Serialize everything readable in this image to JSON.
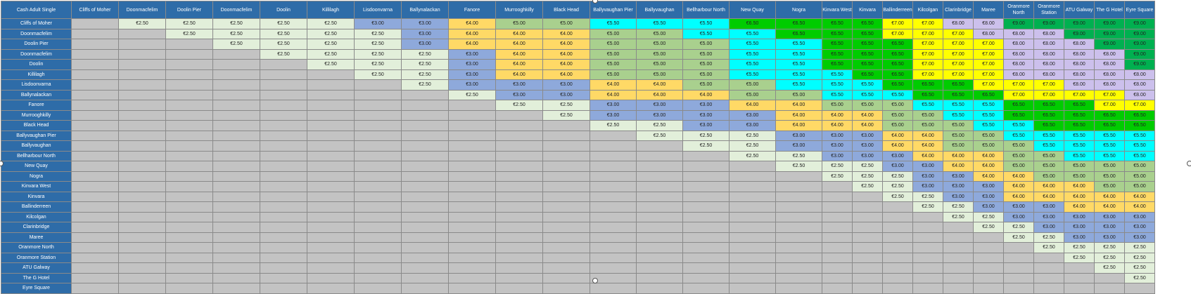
{
  "corner": "Cash Adult Single",
  "stops": [
    "Cliffs of Moher",
    "Doonmacfelim",
    "Doolin Pier",
    "Doonmacfelim",
    "Doolin",
    "Killilagh",
    "Lisdoonvarna",
    "Ballynalackan",
    "Fanore",
    "Murrooghkilly",
    "Black Head",
    "Ballyvaughan Pier",
    "Ballyvaughan",
    "Bellharbour North",
    "New Quay",
    "Nogra",
    "Kinvara West",
    "Kinvara",
    "Ballinderreen",
    "Kilcolgan",
    "Clarinbridge",
    "Maree",
    "Oranmore North",
    "Oranmore Station",
    "ATU Galway",
    "The G Hotel",
    "Eyre Square"
  ],
  "colors": {
    "header_bg": "#2e6ca8",
    "empty": "#c3c3c3",
    "2.50": "#e2efda",
    "3.00": "#8ea9db",
    "4.00": "#ffd966",
    "5.00": "#a9d08e",
    "5.50": "#00ffff",
    "6.50": "#00cc00",
    "7.00": "#ffff00",
    "8.00": "#ccc0ec",
    "9.00": "#00b050"
  },
  "fares": [
    [
      "",
      "€2.50",
      "€2.50",
      "€2.50",
      "€2.50",
      "€2.50",
      "€3.00",
      "€3.00",
      "€4.00",
      "€5.00",
      "€5.00",
      "€5.50",
      "€5.50",
      "€5.50",
      "€6.50",
      "€6.50",
      "€6.50",
      "€6.50",
      "€7.00",
      "€7.00",
      "€8.00",
      "€8.00",
      "€9.00",
      "€9.00",
      "€9.00",
      "€9.00",
      "€9.00"
    ],
    [
      "",
      "",
      "€2.50",
      "€2.50",
      "€2.50",
      "€2.50",
      "€2.50",
      "€3.00",
      "€4.00",
      "€4.00",
      "€4.00",
      "€5.00",
      "€5.00",
      "€5.50",
      "€5.50",
      "€6.50",
      "€6.50",
      "€6.50",
      "€7.00",
      "€7.00",
      "€7.00",
      "€8.00",
      "€8.00",
      "€8.00",
      "€9.00",
      "€9.00",
      "€9.00"
    ],
    [
      "",
      "",
      "",
      "€2.50",
      "€2.50",
      "€2.50",
      "€2.50",
      "€3.00",
      "€4.00",
      "€4.00",
      "€4.00",
      "€5.00",
      "€5.00",
      "€5.00",
      "€5.50",
      "€5.50",
      "€6.50",
      "€6.50",
      "€6.50",
      "€7.00",
      "€7.00",
      "€7.00",
      "€8.00",
      "€8.00",
      "€8.00",
      "€9.00",
      "€9.00"
    ],
    [
      "",
      "",
      "",
      "",
      "€2.50",
      "€2.50",
      "€2.50",
      "€2.50",
      "€3.00",
      "€4.00",
      "€4.00",
      "€5.00",
      "€5.00",
      "€5.00",
      "€5.50",
      "€5.50",
      "€6.50",
      "€6.50",
      "€6.50",
      "€7.00",
      "€7.00",
      "€7.00",
      "€8.00",
      "€8.00",
      "€8.00",
      "€8.00",
      "€9.00"
    ],
    [
      "",
      "",
      "",
      "",
      "",
      "€2.50",
      "€2.50",
      "€2.50",
      "€3.00",
      "€4.00",
      "€4.00",
      "€5.00",
      "€5.00",
      "€5.00",
      "€5.50",
      "€5.50",
      "€6.50",
      "€6.50",
      "€6.50",
      "€7.00",
      "€7.00",
      "€7.00",
      "€8.00",
      "€8.00",
      "€8.00",
      "€8.00",
      "€9.00"
    ],
    [
      "",
      "",
      "",
      "",
      "",
      "",
      "€2.50",
      "€2.50",
      "€3.00",
      "€4.00",
      "€4.00",
      "€5.00",
      "€5.00",
      "€5.00",
      "€5.50",
      "€5.50",
      "€5.50",
      "€6.50",
      "€6.50",
      "€7.00",
      "€7.00",
      "€7.00",
      "€8.00",
      "€8.00",
      "€8.00",
      "€8.00",
      "€8.00"
    ],
    [
      "",
      "",
      "",
      "",
      "",
      "",
      "",
      "€2.50",
      "€3.00",
      "€3.00",
      "€3.00",
      "€4.00",
      "€4.00",
      "€5.00",
      "€5.00",
      "€5.50",
      "€5.50",
      "€5.50",
      "€6.50",
      "€6.50",
      "€6.50",
      "€7.00",
      "€7.00",
      "€7.00",
      "€8.00",
      "€8.00",
      "€8.00"
    ],
    [
      "",
      "",
      "",
      "",
      "",
      "",
      "",
      "",
      "€2.50",
      "€3.00",
      "€3.00",
      "€4.00",
      "€4.00",
      "€4.00",
      "€5.00",
      "€5.00",
      "€5.50",
      "€5.50",
      "€5.50",
      "€6.50",
      "€6.50",
      "€6.50",
      "€7.00",
      "€7.00",
      "€7.00",
      "€7.00",
      "€8.00"
    ],
    [
      "",
      "",
      "",
      "",
      "",
      "",
      "",
      "",
      "",
      "€2.50",
      "€2.50",
      "€3.00",
      "€3.00",
      "€3.00",
      "€4.00",
      "€4.00",
      "€5.00",
      "€5.00",
      "€5.00",
      "€5.50",
      "€5.50",
      "€5.50",
      "€6.50",
      "€6.50",
      "€6.50",
      "€7.00",
      "€7.00"
    ],
    [
      "",
      "",
      "",
      "",
      "",
      "",
      "",
      "",
      "",
      "",
      "€2.50",
      "€3.00",
      "€3.00",
      "€3.00",
      "€3.00",
      "€4.00",
      "€4.00",
      "€4.00",
      "€5.00",
      "€5.00",
      "€5.50",
      "€5.50",
      "€6.50",
      "€6.50",
      "€6.50",
      "€6.50",
      "€6.50"
    ],
    [
      "",
      "",
      "",
      "",
      "",
      "",
      "",
      "",
      "",
      "",
      "",
      "€2.50",
      "€2.50",
      "€3.00",
      "€3.00",
      "€4.00",
      "€4.00",
      "€4.00",
      "€5.00",
      "€5.00",
      "€5.00",
      "€5.50",
      "€5.50",
      "€6.50",
      "€6.50",
      "€6.50",
      "€6.50"
    ],
    [
      "",
      "",
      "",
      "",
      "",
      "",
      "",
      "",
      "",
      "",
      "",
      "",
      "€2.50",
      "€2.50",
      "€2.50",
      "€3.00",
      "€3.00",
      "€3.00",
      "€4.00",
      "€4.00",
      "€5.00",
      "€5.00",
      "€5.50",
      "€5.50",
      "€5.50",
      "€5.50",
      "€5.50"
    ],
    [
      "",
      "",
      "",
      "",
      "",
      "",
      "",
      "",
      "",
      "",
      "",
      "",
      "",
      "€2.50",
      "€2.50",
      "€3.00",
      "€3.00",
      "€3.00",
      "€4.00",
      "€4.00",
      "€5.00",
      "€5.00",
      "€5.00",
      "€5.50",
      "€5.50",
      "€5.50",
      "€5.50"
    ],
    [
      "",
      "",
      "",
      "",
      "",
      "",
      "",
      "",
      "",
      "",
      "",
      "",
      "",
      "",
      "€2.50",
      "€2.50",
      "€3.00",
      "€3.00",
      "€3.00",
      "€4.00",
      "€4.00",
      "€4.00",
      "€5.00",
      "€5.00",
      "€5.50",
      "€5.50",
      "€5.50"
    ],
    [
      "",
      "",
      "",
      "",
      "",
      "",
      "",
      "",
      "",
      "",
      "",
      "",
      "",
      "",
      "",
      "€2.50",
      "€2.50",
      "€2.50",
      "€3.00",
      "€3.00",
      "€4.00",
      "€4.00",
      "€5.00",
      "€5.00",
      "€5.00",
      "€5.00",
      "€5.00"
    ],
    [
      "",
      "",
      "",
      "",
      "",
      "",
      "",
      "",
      "",
      "",
      "",
      "",
      "",
      "",
      "",
      "",
      "€2.50",
      "€2.50",
      "€2.50",
      "€3.00",
      "€3.00",
      "€4.00",
      "€4.00",
      "€5.00",
      "€5.00",
      "€5.00",
      "€5.00"
    ],
    [
      "",
      "",
      "",
      "",
      "",
      "",
      "",
      "",
      "",
      "",
      "",
      "",
      "",
      "",
      "",
      "",
      "",
      "€2.50",
      "€2.50",
      "€3.00",
      "€3.00",
      "€3.00",
      "€4.00",
      "€4.00",
      "€4.00",
      "€5.00",
      "€5.00"
    ],
    [
      "",
      "",
      "",
      "",
      "",
      "",
      "",
      "",
      "",
      "",
      "",
      "",
      "",
      "",
      "",
      "",
      "",
      "",
      "€2.50",
      "€2.50",
      "€3.00",
      "€3.00",
      "€4.00",
      "€4.00",
      "€4.00",
      "€4.00",
      "€4.00"
    ],
    [
      "",
      "",
      "",
      "",
      "",
      "",
      "",
      "",
      "",
      "",
      "",
      "",
      "",
      "",
      "",
      "",
      "",
      "",
      "",
      "€2.50",
      "€2.50",
      "€3.00",
      "€3.00",
      "€3.00",
      "€4.00",
      "€4.00",
      "€4.00"
    ],
    [
      "",
      "",
      "",
      "",
      "",
      "",
      "",
      "",
      "",
      "",
      "",
      "",
      "",
      "",
      "",
      "",
      "",
      "",
      "",
      "",
      "€2.50",
      "€2.50",
      "€3.00",
      "€3.00",
      "€3.00",
      "€3.00",
      "€3.00"
    ],
    [
      "",
      "",
      "",
      "",
      "",
      "",
      "",
      "",
      "",
      "",
      "",
      "",
      "",
      "",
      "",
      "",
      "",
      "",
      "",
      "",
      "",
      "€2.50",
      "€2.50",
      "€3.00",
      "€3.00",
      "€3.00",
      "€3.00"
    ],
    [
      "",
      "",
      "",
      "",
      "",
      "",
      "",
      "",
      "",
      "",
      "",
      "",
      "",
      "",
      "",
      "",
      "",
      "",
      "",
      "",
      "",
      "",
      "€2.50",
      "€2.50",
      "€3.00",
      "€3.00",
      "€3.00"
    ],
    [
      "",
      "",
      "",
      "",
      "",
      "",
      "",
      "",
      "",
      "",
      "",
      "",
      "",
      "",
      "",
      "",
      "",
      "",
      "",
      "",
      "",
      "",
      "",
      "€2.50",
      "€2.50",
      "€2.50",
      "€2.50"
    ],
    [
      "",
      "",
      "",
      "",
      "",
      "",
      "",
      "",
      "",
      "",
      "",
      "",
      "",
      "",
      "",
      "",
      "",
      "",
      "",
      "",
      "",
      "",
      "",
      "",
      "€2.50",
      "€2.50",
      "€2.50"
    ],
    [
      "",
      "",
      "",
      "",
      "",
      "",
      "",
      "",
      "",
      "",
      "",
      "",
      "",
      "",
      "",
      "",
      "",
      "",
      "",
      "",
      "",
      "",
      "",
      "",
      "",
      "€2.50",
      "€2.50"
    ],
    [
      "",
      "",
      "",
      "",
      "",
      "",
      "",
      "",
      "",
      "",
      "",
      "",
      "",
      "",
      "",
      "",
      "",
      "",
      "",
      "",
      "",
      "",
      "",
      "",
      "",
      "",
      "€2.50"
    ],
    [
      "",
      "",
      "",
      "",
      "",
      "",
      "",
      "",
      "",
      "",
      "",
      "",
      "",
      "",
      "",
      "",
      "",
      "",
      "",
      "",
      "",
      "",
      "",
      "",
      "",
      "",
      ""
    ]
  ]
}
